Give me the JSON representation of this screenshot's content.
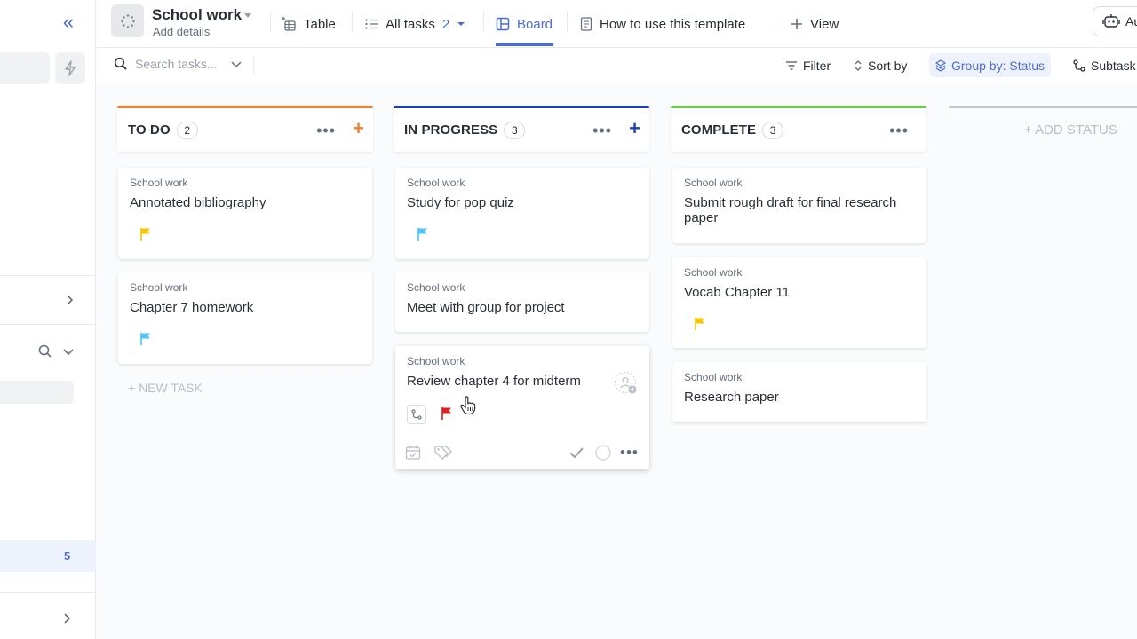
{
  "sidebar": {
    "badge_count": "5"
  },
  "header": {
    "space_title": "School work",
    "space_subtitle": "Add details",
    "tabs": [
      {
        "label": "Table"
      },
      {
        "label": "All tasks",
        "count": "2"
      },
      {
        "label": "Board"
      },
      {
        "label": "How to use this template"
      },
      {
        "label": "View"
      }
    ],
    "automation_label": "Au"
  },
  "toolbar": {
    "search_placeholder": "Search tasks...",
    "filter_label": "Filter",
    "sort_label": "Sort by",
    "group_label": "Group by: Status",
    "subtasks_label": "Subtask"
  },
  "board": {
    "columns": [
      {
        "name": "TO DO",
        "count": "2",
        "color": "#f2802e",
        "tasks": [
          {
            "list": "School work",
            "name": "Annotated bibliography",
            "flag_color": "#f8c400"
          },
          {
            "list": "School work",
            "name": "Chapter 7 homework",
            "flag_color": "#4fc3f7"
          }
        ],
        "new_task_label": "+ NEW TASK"
      },
      {
        "name": "IN PROGRESS",
        "count": "3",
        "color": "#1d3fbb",
        "tasks": [
          {
            "list": "School work",
            "name": "Study for pop quiz",
            "flag_color": "#4fc3f7"
          },
          {
            "list": "School work",
            "name": "Meet with group for project"
          },
          {
            "list": "School work",
            "name": "Review chapter 4 for midterm",
            "flag_color": "#e02020"
          }
        ]
      },
      {
        "name": "COMPLETE",
        "count": "3",
        "color": "#6bc950",
        "tasks": [
          {
            "list": "School work",
            "name": "Submit rough draft for final research paper"
          },
          {
            "list": "School work",
            "name": "Vocab Chapter 11",
            "flag_color": "#f8c400"
          },
          {
            "list": "School work",
            "name": "Research paper"
          }
        ]
      }
    ],
    "add_status_label": "+ ADD STATUS"
  }
}
